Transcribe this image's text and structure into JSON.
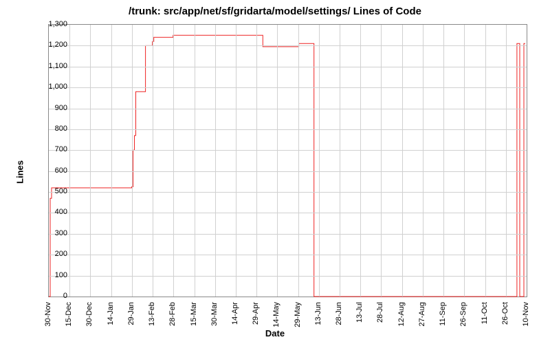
{
  "chart_data": {
    "type": "line",
    "title": "/trunk: src/app/net/sf/gridarta/model/settings/ Lines of Code",
    "xlabel": "Date",
    "ylabel": "Lines",
    "ylim": [
      0,
      1300
    ],
    "y_ticks": [
      0,
      100,
      200,
      300,
      400,
      500,
      600,
      700,
      800,
      900,
      1000,
      1100,
      1200,
      1300
    ],
    "y_tick_labels": [
      "0",
      "100",
      "200",
      "300",
      "400",
      "500",
      "600",
      "700",
      "800",
      "900",
      "1,000",
      "1,100",
      "1,200",
      "1,300"
    ],
    "x_categories": [
      "30-Nov",
      "15-Dec",
      "30-Dec",
      "14-Jan",
      "29-Jan",
      "13-Feb",
      "28-Feb",
      "15-Mar",
      "30-Mar",
      "14-Apr",
      "29-Apr",
      "14-May",
      "29-May",
      "13-Jun",
      "28-Jun",
      "13-Jul",
      "28-Jul",
      "12-Aug",
      "27-Aug",
      "11-Sep",
      "26-Sep",
      "11-Oct",
      "26-Oct",
      "10-Nov"
    ],
    "series": [
      {
        "name": "Lines of Code",
        "x": [
          "30-Nov",
          "01-Dec",
          "02-Dec",
          "29-Jan",
          "30-Jan",
          "31-Jan",
          "01-Feb",
          "08-Feb",
          "13-Feb",
          "14-Feb",
          "28-Feb",
          "29-Apr",
          "03-May",
          "10-May",
          "29-May",
          "08-Jun",
          "09-Jun",
          "23-Jun",
          "03-Nov",
          "04-Nov",
          "05-Nov",
          "07-Nov",
          "08-Nov",
          "09-Nov"
        ],
        "y": [
          0,
          470,
          520,
          525,
          700,
          770,
          980,
          1200,
          1220,
          1240,
          1250,
          1250,
          1195,
          1195,
          1210,
          1210,
          0,
          0,
          1210,
          1210,
          0,
          0,
          1210,
          1210
        ]
      }
    ]
  }
}
